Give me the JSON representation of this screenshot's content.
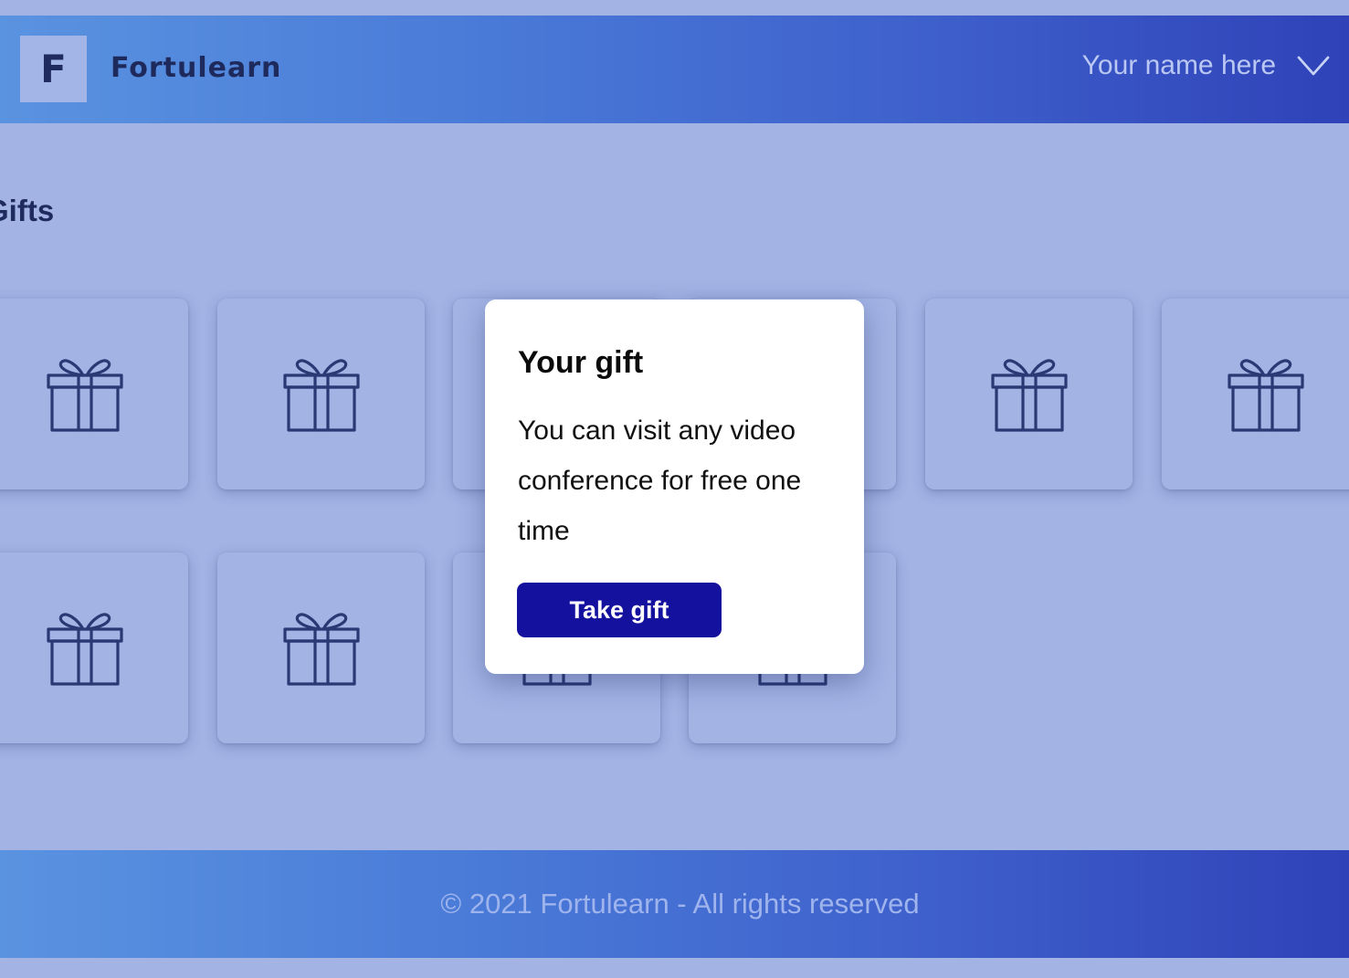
{
  "header": {
    "logo_letter": "F",
    "brand_name": "Fortulearn",
    "user_name": "Your name here",
    "user_menu_icon": "chevron-down-icon"
  },
  "page": {
    "title": "Gifts"
  },
  "gifts": {
    "card_icon": "gift-icon",
    "count": 10
  },
  "modal": {
    "title": "Your gift",
    "text": "You can visit any video conference for free one time",
    "button_label": "Take gift"
  },
  "footer": {
    "text": "© 2021 Fortulearn - All rights reserved"
  },
  "colors": {
    "background": "#a2b3e4",
    "header_gradient_start": "#5a93e0",
    "header_gradient_end": "#2f42b8",
    "primary_button": "#14119f",
    "icon_stroke": "#2a3874"
  }
}
